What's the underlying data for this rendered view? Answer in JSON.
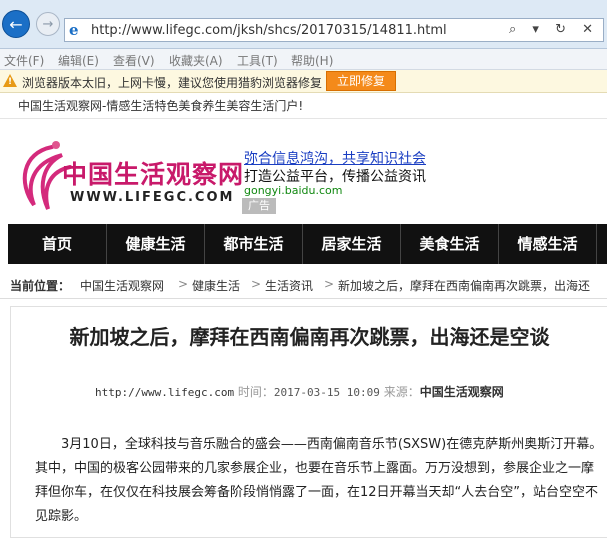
{
  "browser": {
    "url": "http://www.lifegc.com/jksh/shcs/20170315/14811.html",
    "url_icons": "⌕ ▾ ↻ ✕",
    "menu": [
      "文件(F)",
      "编辑(E)",
      "查看(V)",
      "收藏夹(A)",
      "工具(T)",
      "帮助(H)"
    ],
    "warning": {
      "text": "浏览器版本太旧，上网卡慢，建议您使用猎豹浏览器修复",
      "button": "立即修复"
    }
  },
  "site": {
    "top_tagline": "中国生活观察网-情感生活特色美食养生美容生活门户!",
    "logo": {
      "cn": "中国生活观察网",
      "en": "WWW.LIFEGC.COM"
    },
    "ad": {
      "line1": "弥合信息鸿沟，共享知识社会",
      "line2": "打造公益平台，传播公益资讯",
      "domain": "gongyi.baidu.com",
      "tag": "广告"
    },
    "nav": [
      "首页",
      "健康生活",
      "都市生活",
      "居家生活",
      "美食生活",
      "情感生活"
    ],
    "breadcrumb": {
      "label": "当前位置：",
      "items": [
        "中国生活观察网",
        "健康生活",
        "生活资讯",
        "新加坡之后，摩拜在西南偏南再次跳票，出海还"
      ],
      "sep": ">"
    }
  },
  "article": {
    "title": "新加坡之后，摩拜在西南偏南再次跳票，出海还是空谈",
    "site_url": "http://www.lifegc.com",
    "time_label": "时间：",
    "time": "2017-03-15 10:09",
    "source_label": "来源：",
    "source": "中国生活观察网",
    "paragraph": "3月10日，全球科技与音乐融合的盛会——西南偏南音乐节(SXSW)在德克萨斯州奥斯汀开幕。其中，中国的极客公园带来的几家参展企业，也要在音乐节上露面。万万没想到，参展企业之一摩拜但你车，在仅仅在科技展会筹备阶段悄悄露了一面，在12日开幕当天却“人去台空”，站台空空不见踪影。"
  }
}
